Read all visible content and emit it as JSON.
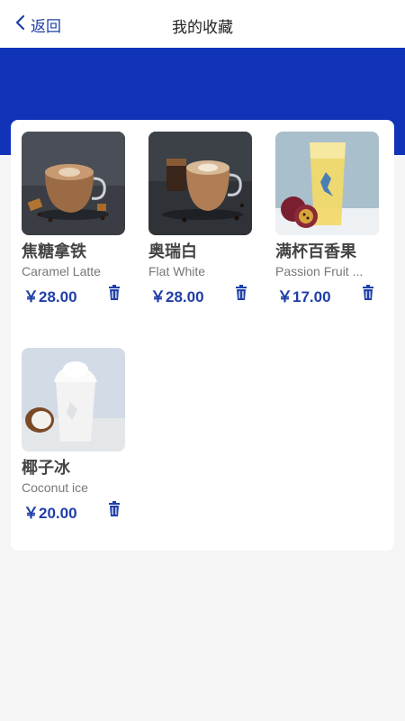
{
  "header": {
    "back_label": "返回",
    "title": "我的收藏"
  },
  "colors": {
    "accent": "#1f3fa8",
    "banner": "#1033b8"
  },
  "favorites": [
    {
      "name": "焦糖拿铁",
      "english": "Caramel Latte",
      "price": "￥28.00",
      "image": "caramel-latte-photo"
    },
    {
      "name": "奥瑞白",
      "english": "Flat White",
      "price": "￥28.00",
      "image": "flat-white-photo"
    },
    {
      "name": "满杯百香果",
      "english": "Passion Fruit ...",
      "price": "￥17.00",
      "image": "passion-fruit-tea-photo"
    },
    {
      "name": "椰子冰",
      "english": "Coconut ice",
      "price": "￥20.00",
      "image": "coconut-ice-photo"
    }
  ]
}
